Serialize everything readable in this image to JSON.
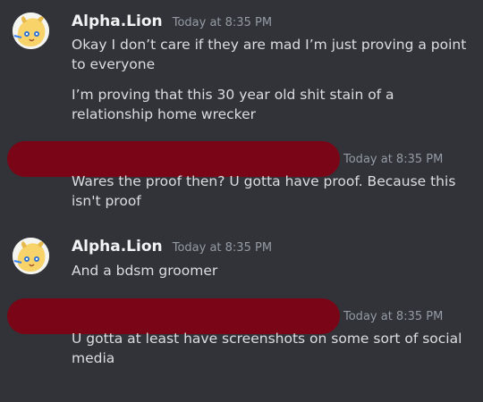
{
  "messages": [
    {
      "username": "Alpha.Lion",
      "timestamp": "Today at 8:35 PM",
      "lines": [
        "Okay I don’t care if they are mad I’m just proving a point to everyone",
        "I’m proving that this 30 year old shit stain of a relationship home wrecker"
      ]
    },
    {
      "username_redacted": true,
      "timestamp": "Today at 8:35 PM",
      "lines": [
        "Wares the proof then? U gotta have proof. Because this isn't proof"
      ]
    },
    {
      "username": "Alpha.Lion",
      "timestamp": "Today at 8:35 PM",
      "lines": [
        "And a bdsm groomer"
      ]
    },
    {
      "username_redacted": true,
      "timestamp": "Today at 8:35 PM",
      "lines": [
        "U gotta at least have screenshots on some sort of social media"
      ]
    }
  ],
  "colors": {
    "background": "#313338",
    "redaction": "#7a0516",
    "username": "#f2f3f5",
    "text": "#dbdee1",
    "timestamp": "#949ba4"
  }
}
